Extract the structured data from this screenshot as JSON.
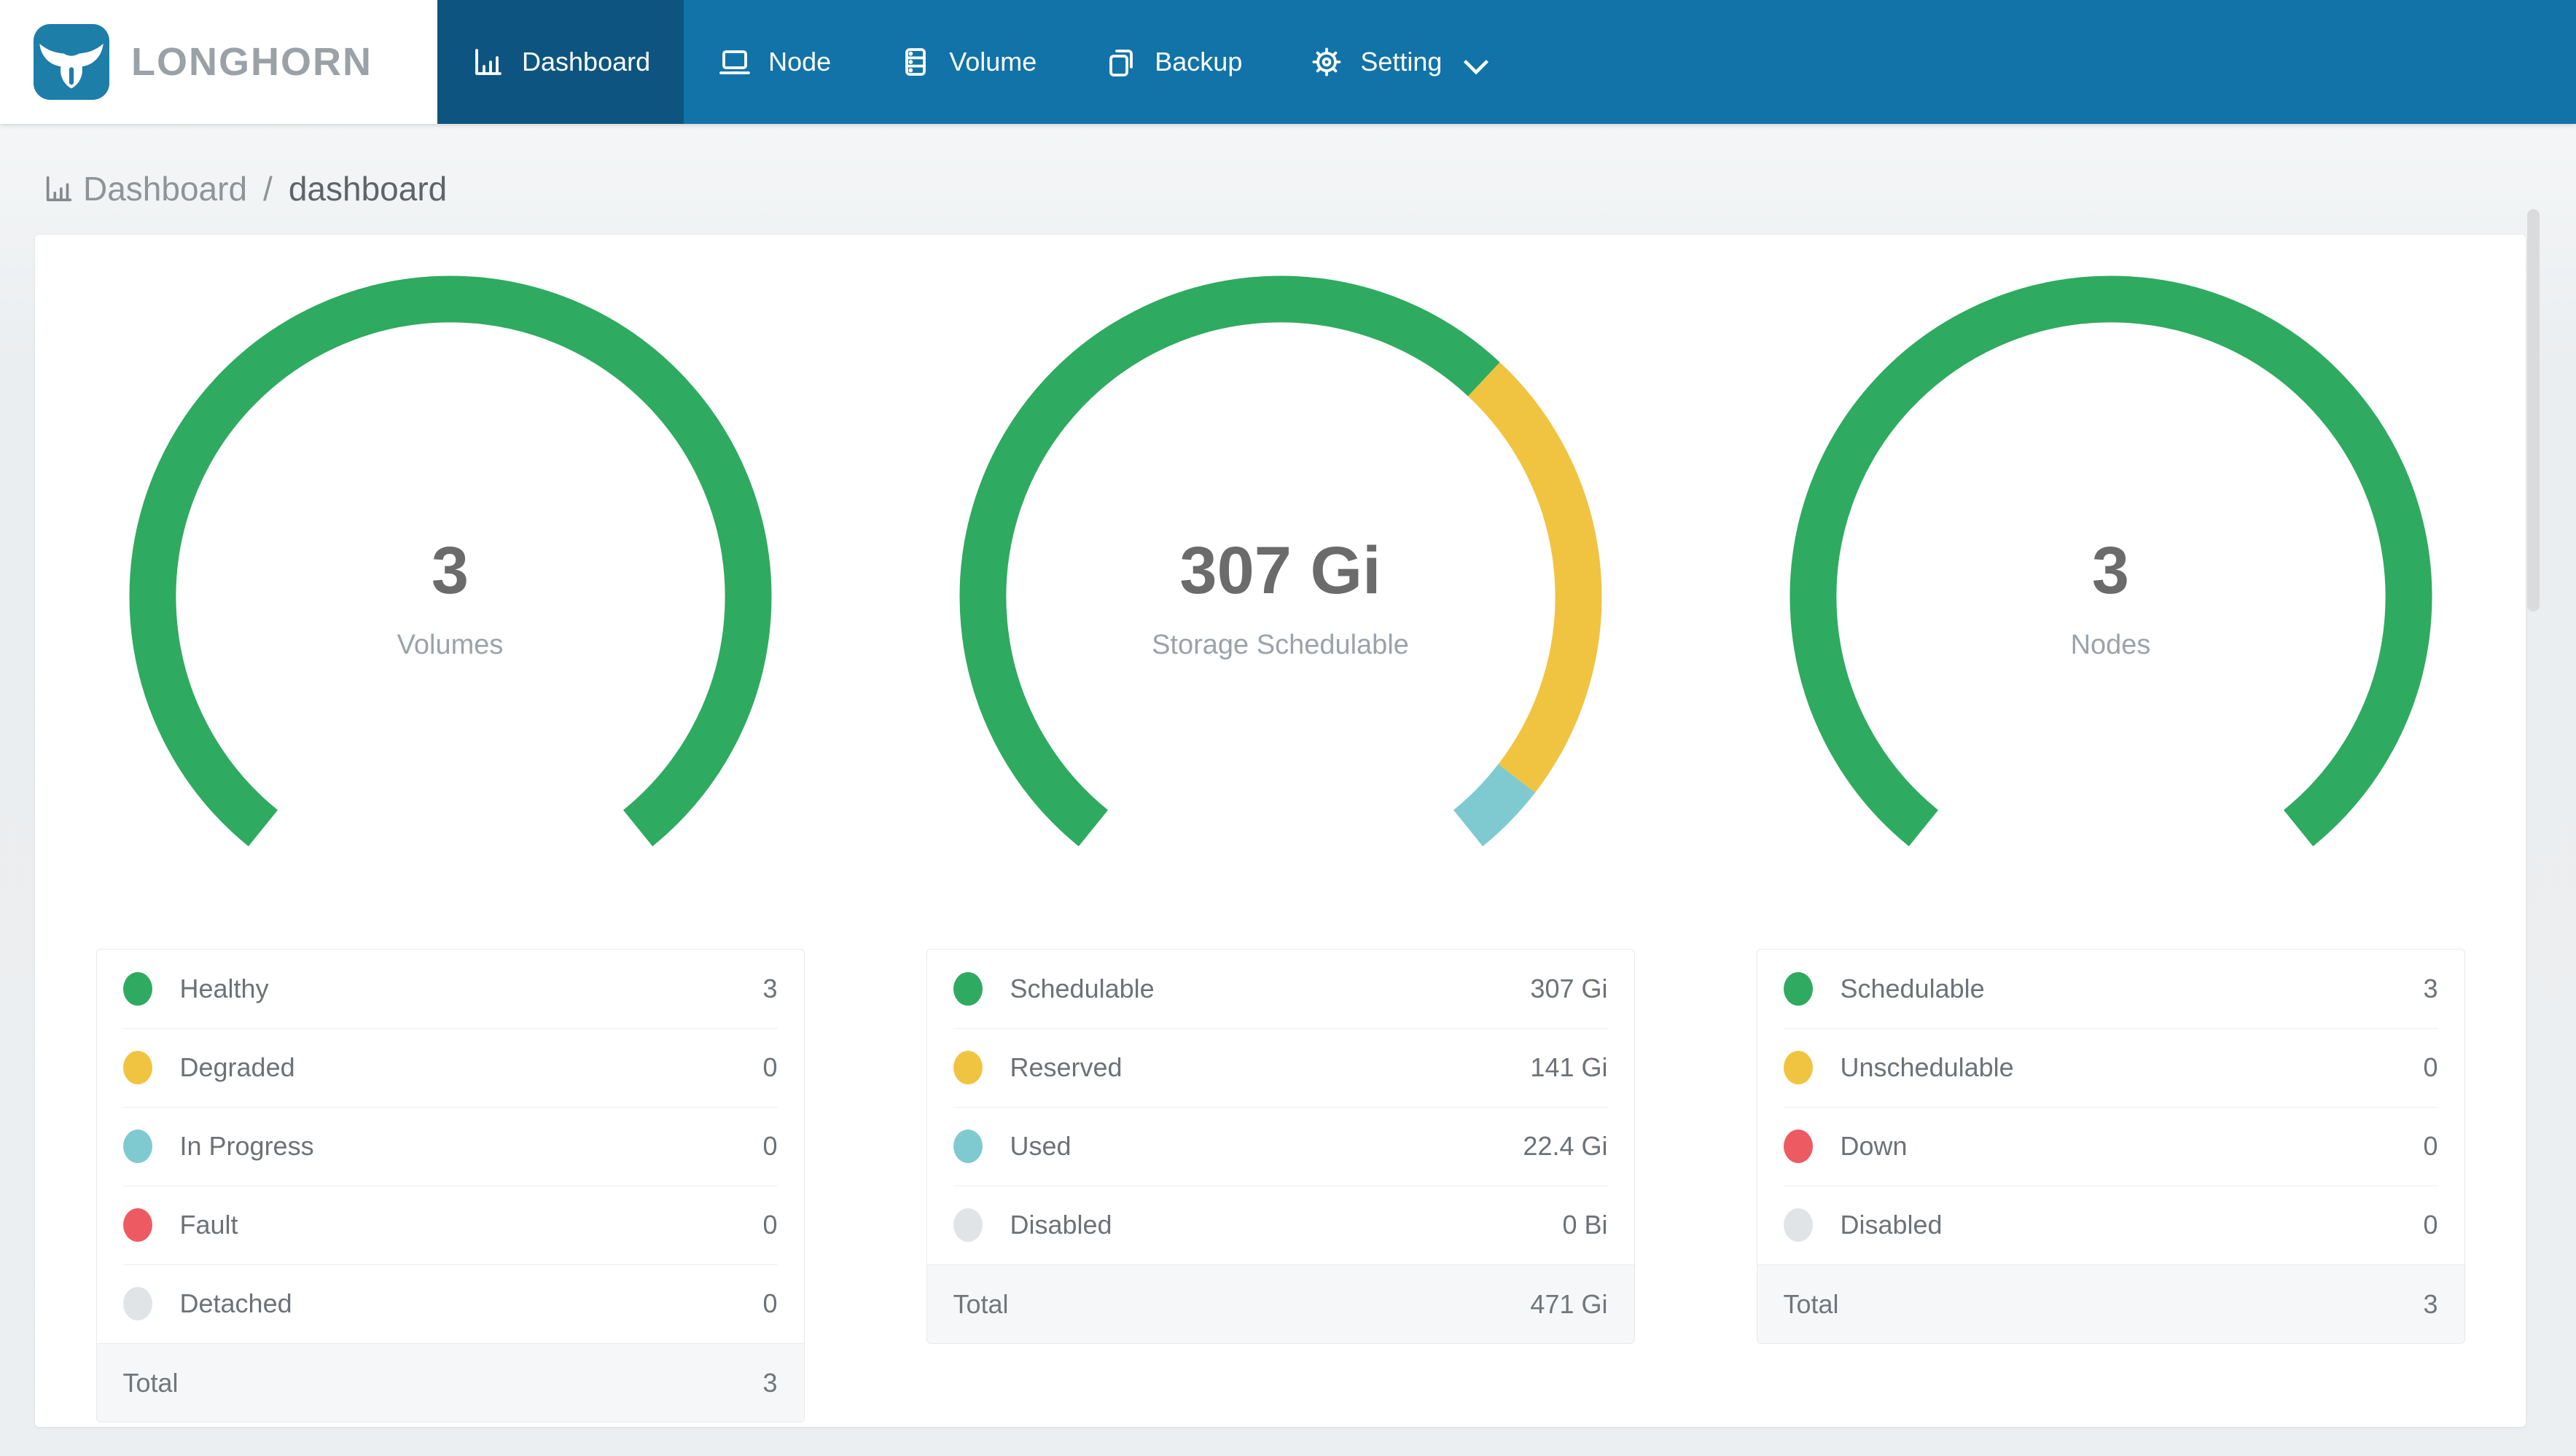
{
  "app": {
    "logo_text": "LONGHORN",
    "nav": [
      {
        "label": "Dashboard",
        "icon": "bar-chart-icon",
        "active": true
      },
      {
        "label": "Node",
        "icon": "laptop-icon",
        "active": false
      },
      {
        "label": "Volume",
        "icon": "database-icon",
        "active": false
      },
      {
        "label": "Backup",
        "icon": "copy-icon",
        "active": false
      },
      {
        "label": "Setting",
        "icon": "gear-icon",
        "active": false,
        "has_dropdown": true
      }
    ]
  },
  "breadcrumb": {
    "icon": "bar-chart-icon",
    "section": "Dashboard",
    "separator": "/",
    "current": "dashboard"
  },
  "colors": {
    "green": "#2FAA61",
    "yellow": "#F0C440",
    "teal": "#7FCAD1",
    "red": "#EE5A62",
    "gray": "#E1E4E7",
    "navbar": "#1173A7",
    "navbar_active": "#0D5580"
  },
  "chart_data": [
    {
      "type": "donut-gauge",
      "arc_degrees": 282,
      "center_value": "3",
      "center_label": "Volumes",
      "segments": [
        {
          "label": "Healthy",
          "value": 3,
          "color": "#2FAA61"
        },
        {
          "label": "Degraded",
          "value": 0,
          "color": "#F0C440"
        },
        {
          "label": "In Progress",
          "value": 0,
          "color": "#7FCAD1"
        },
        {
          "label": "Fault",
          "value": 0,
          "color": "#EE5A62"
        },
        {
          "label": "Detached",
          "value": 0,
          "color": "#E1E4E7"
        }
      ],
      "legend": [
        {
          "label": "Healthy",
          "display": "3",
          "color": "#2FAA61"
        },
        {
          "label": "Degraded",
          "display": "0",
          "color": "#F0C440"
        },
        {
          "label": "In Progress",
          "display": "0",
          "color": "#7FCAD1"
        },
        {
          "label": "Fault",
          "display": "0",
          "color": "#EE5A62"
        },
        {
          "label": "Detached",
          "display": "0",
          "color": "#E1E4E7"
        }
      ],
      "total": {
        "label": "Total",
        "display": "3"
      }
    },
    {
      "type": "donut-gauge",
      "arc_degrees": 282,
      "center_value": "307 Gi",
      "center_label": "Storage Schedulable",
      "segments": [
        {
          "label": "Schedulable",
          "value": 307,
          "color": "#2FAA61"
        },
        {
          "label": "Reserved",
          "value": 141,
          "color": "#F0C440"
        },
        {
          "label": "Used",
          "value": 22.4,
          "color": "#7FCAD1"
        },
        {
          "label": "Disabled",
          "value": 0,
          "color": "#E1E4E7"
        }
      ],
      "legend": [
        {
          "label": "Schedulable",
          "display": "307 Gi",
          "color": "#2FAA61"
        },
        {
          "label": "Reserved",
          "display": "141 Gi",
          "color": "#F0C440"
        },
        {
          "label": "Used",
          "display": "22.4 Gi",
          "color": "#7FCAD1"
        },
        {
          "label": "Disabled",
          "display": "0 Bi",
          "color": "#E1E4E7"
        }
      ],
      "total": {
        "label": "Total",
        "display": "471 Gi"
      }
    },
    {
      "type": "donut-gauge",
      "arc_degrees": 282,
      "center_value": "3",
      "center_label": "Nodes",
      "segments": [
        {
          "label": "Schedulable",
          "value": 3,
          "color": "#2FAA61"
        },
        {
          "label": "Unschedulable",
          "value": 0,
          "color": "#F0C440"
        },
        {
          "label": "Down",
          "value": 0,
          "color": "#EE5A62"
        },
        {
          "label": "Disabled",
          "value": 0,
          "color": "#E1E4E7"
        }
      ],
      "legend": [
        {
          "label": "Schedulable",
          "display": "3",
          "color": "#2FAA61"
        },
        {
          "label": "Unschedulable",
          "display": "0",
          "color": "#F0C440"
        },
        {
          "label": "Down",
          "display": "0",
          "color": "#EE5A62"
        },
        {
          "label": "Disabled",
          "display": "0",
          "color": "#E1E4E7"
        }
      ],
      "total": {
        "label": "Total",
        "display": "3"
      }
    }
  ]
}
